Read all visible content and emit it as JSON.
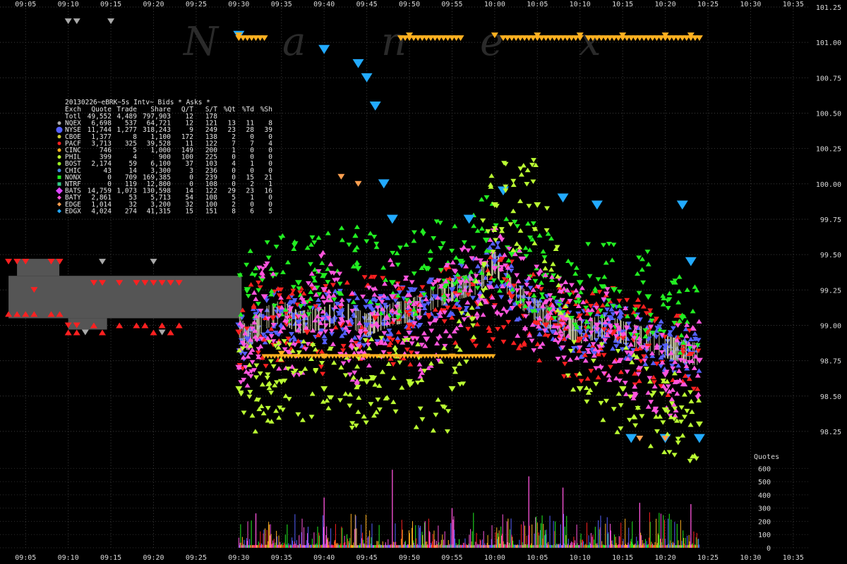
{
  "chart_data": [
    {
      "type": "scatter",
      "title": "",
      "watermark": [
        "N",
        "a",
        "n",
        "e",
        "x"
      ],
      "xlabel": "",
      "ylabel": "",
      "x_ticks": [
        "09:05",
        "09:10",
        "09:15",
        "09:20",
        "09:25",
        "09:30",
        "09:35",
        "09:40",
        "09:45",
        "09:50",
        "09:55",
        "10:00",
        "10:05",
        "10:10",
        "10:15",
        "10:20",
        "10:25",
        "10:30",
        "10:35"
      ],
      "xlim": [
        "09:02",
        "10:37"
      ],
      "y_ticks": [
        "98.25",
        "98.50",
        "98.75",
        "99.00",
        "99.25",
        "99.50",
        "99.75",
        "100.00",
        "100.25",
        "100.50",
        "100.75",
        "101.00",
        "101.25"
      ],
      "ylim": [
        98.15,
        101.25
      ],
      "grid": true,
      "series": [
        {
          "name": "NYSE",
          "color": "#5560ff",
          "x": [
            "09:30",
            "09:31",
            "09:33",
            "09:35",
            "09:37",
            "09:40",
            "09:42",
            "09:45",
            "09:48",
            "09:50",
            "09:53",
            "09:55",
            "09:58",
            "10:00",
            "10:02",
            "10:05",
            "10:08",
            "10:10",
            "10:13",
            "10:15",
            "10:18",
            "10:20",
            "10:23"
          ],
          "y": [
            99.0,
            98.9,
            99.05,
            99.1,
            99.02,
            99.05,
            99.1,
            99.0,
            99.08,
            99.1,
            99.2,
            99.25,
            99.3,
            99.45,
            99.25,
            99.1,
            99.0,
            98.95,
            99.0,
            98.95,
            98.9,
            98.85,
            98.8
          ]
        },
        {
          "name": "PACF",
          "color": "#ff2020",
          "x": [
            "09:30",
            "09:34",
            "09:38",
            "09:42",
            "09:46",
            "09:50",
            "09:54",
            "09:58",
            "10:02",
            "10:06",
            "10:10",
            "10:14",
            "10:18",
            "10:22"
          ],
          "y": [
            98.95,
            99.05,
            98.95,
            99.0,
            99.05,
            99.0,
            99.1,
            99.15,
            99.2,
            99.0,
            98.9,
            98.95,
            98.85,
            98.8
          ]
        },
        {
          "name": "NONX",
          "color": "#22ee22",
          "x": [
            "09:31",
            "09:34",
            "09:37",
            "09:40",
            "09:44",
            "09:48",
            "09:52",
            "09:56",
            "09:59",
            "10:02",
            "10:06",
            "10:10",
            "10:14",
            "10:18",
            "10:22"
          ],
          "y": [
            99.25,
            99.35,
            99.3,
            99.35,
            99.4,
            99.3,
            99.4,
            99.45,
            99.6,
            99.5,
            99.35,
            99.3,
            99.25,
            99.2,
            99.05
          ]
        },
        {
          "name": "BATS",
          "color": "#ff55dd",
          "x": [
            "09:30",
            "09:33",
            "09:36",
            "09:40",
            "09:44",
            "09:48",
            "09:52",
            "09:56",
            "10:00",
            "10:04",
            "10:08",
            "10:12",
            "10:16",
            "10:20",
            "10:24"
          ],
          "y": [
            98.7,
            99.2,
            98.8,
            99.25,
            98.85,
            99.2,
            98.9,
            99.3,
            99.4,
            99.15,
            99.05,
            99.0,
            98.8,
            98.65,
            98.75
          ]
        },
        {
          "name": "EDGX",
          "color": "#22aaff",
          "x": [
            "09:30",
            "09:40",
            "09:44",
            "09:45",
            "09:46",
            "09:47",
            "09:48",
            "09:57",
            "10:01",
            "10:08",
            "10:12",
            "10:16",
            "10:20",
            "10:22",
            "10:23",
            "10:24"
          ],
          "y": [
            101.05,
            100.95,
            100.85,
            100.75,
            100.55,
            100.0,
            99.75,
            99.75,
            99.95,
            99.9,
            99.85,
            98.2,
            98.2,
            99.85,
            99.45,
            98.2
          ]
        },
        {
          "name": "CINC",
          "color": "#ffb020",
          "x": [
            "09:30",
            "09:35",
            "09:40",
            "09:45",
            "09:50",
            "09:55",
            "10:00",
            "10:05",
            "10:10",
            "10:15",
            "10:20",
            "10:23"
          ],
          "y": [
            101.05,
            98.8,
            98.78,
            98.78,
            101.05,
            98.78,
            101.05,
            101.05,
            101.05,
            101.05,
            101.05,
            101.05
          ]
        },
        {
          "name": "PHIL",
          "color": "#bbff33",
          "x": [
            "09:30",
            "09:35",
            "09:40",
            "09:45",
            "09:50",
            "09:55",
            "10:00",
            "10:05",
            "10:10",
            "10:15",
            "10:20",
            "10:24"
          ],
          "y": [
            98.55,
            98.6,
            98.55,
            98.6,
            98.6,
            98.55,
            99.85,
            99.85,
            98.55,
            98.55,
            98.4,
            98.3
          ]
        },
        {
          "name": "NQEX",
          "color": "#aaaaaa",
          "x": [
            "09:10",
            "09:11",
            "09:12",
            "09:14",
            "09:15",
            "09:20",
            "09:21"
          ],
          "y": [
            101.15,
            101.15,
            98.95,
            99.45,
            101.15,
            99.45,
            98.95
          ]
        },
        {
          "name": "EDGE",
          "color": "#ffa050",
          "x": [
            "09:42",
            "09:44",
            "10:17",
            "10:20"
          ],
          "y": [
            100.05,
            100.0,
            98.2,
            98.2
          ]
        }
      ],
      "pre_open_band": {
        "x_start": "09:03",
        "x_end": "09:30",
        "y_low": 99.05,
        "y_high": 99.35,
        "color": "#555555"
      },
      "pre_open_quotes": {
        "color": "#ff2020",
        "x": [
          "09:03",
          "09:04",
          "09:05",
          "09:06",
          "09:08",
          "09:09",
          "09:10",
          "09:11",
          "09:13",
          "09:14",
          "09:16",
          "09:18",
          "09:19",
          "09:20",
          "09:21",
          "09:22",
          "09:23"
        ],
        "y_ask": [
          99.45,
          99.45,
          99.45,
          99.25,
          99.45,
          99.45,
          99.0,
          99.0,
          99.3,
          99.3,
          99.3,
          99.3,
          99.3,
          99.3,
          99.3,
          99.3,
          99.3
        ],
        "y_bid": [
          99.08,
          99.08,
          99.08,
          99.08,
          99.08,
          99.08,
          98.95,
          98.95,
          99.0,
          98.95,
          99.0,
          99.0,
          99.0,
          98.95,
          99.0,
          98.95,
          99.0
        ]
      }
    },
    {
      "type": "bar",
      "title": "",
      "ylabel": "Quotes",
      "y_ticks": [
        "0",
        "100",
        "200",
        "300",
        "400",
        "500",
        "600"
      ],
      "ylim": [
        0,
        650
      ],
      "peaks": [
        {
          "x": "09:48",
          "value": 590
        },
        {
          "x": "10:08",
          "value": 455
        },
        {
          "x": "10:04",
          "value": 540
        },
        {
          "x": "09:40",
          "value": 380
        },
        {
          "x": "10:17",
          "value": 340
        },
        {
          "x": "10:23",
          "value": 330
        },
        {
          "x": "09:32",
          "value": 260
        },
        {
          "x": "09:55",
          "value": 300
        }
      ],
      "colors": [
        "#ff55dd",
        "#5560ff",
        "#22ee22",
        "#ffb020",
        "#ff2020"
      ]
    }
  ],
  "stats_table": {
    "title": "20130226~eBRK~5s Intv~ Bids * Asks *",
    "columns": [
      "Exch",
      "Quote",
      "Trade",
      "Share",
      "Q/T",
      "S/T",
      "%Qt",
      "%Td",
      "%Sh"
    ],
    "rows": [
      {
        "exch": "Totl",
        "quote": "49,552",
        "trade": "4,489",
        "share": "797,903",
        "qt": "12",
        "st": "178",
        "pq": "",
        "pt": "",
        "ps": "",
        "color": "",
        "marker": "none"
      },
      {
        "exch": "NQEX",
        "quote": "6,698",
        "trade": "537",
        "share": "64,721",
        "qt": "12",
        "st": "121",
        "pq": "13",
        "pt": "11",
        "ps": "8",
        "color": "#aaaaaa",
        "marker": "circle"
      },
      {
        "exch": "NYSE",
        "quote": "11,744",
        "trade": "1,277",
        "share": "318,243",
        "qt": "9",
        "st": "249",
        "pq": "23",
        "pt": "28",
        "ps": "39",
        "color": "#5560ff",
        "marker": "big-circle"
      },
      {
        "exch": "CBOE",
        "quote": "1,377",
        "trade": "8",
        "share": "1,100",
        "qt": "172",
        "st": "138",
        "pq": "2",
        "pt": "0",
        "ps": "0",
        "color": "#cccc33",
        "marker": "circle"
      },
      {
        "exch": "PACF",
        "quote": "3,713",
        "trade": "325",
        "share": "39,528",
        "qt": "11",
        "st": "122",
        "pq": "7",
        "pt": "7",
        "ps": "4",
        "color": "#ff2020",
        "marker": "circle"
      },
      {
        "exch": "CINC",
        "quote": "746",
        "trade": "5",
        "share": "1,000",
        "qt": "149",
        "st": "200",
        "pq": "1",
        "pt": "0",
        "ps": "0",
        "color": "#ffb020",
        "marker": "circle"
      },
      {
        "exch": "PHIL",
        "quote": "399",
        "trade": "4",
        "share": "900",
        "qt": "100",
        "st": "225",
        "pq": "0",
        "pt": "0",
        "ps": "0",
        "color": "#bbff33",
        "marker": "circle"
      },
      {
        "exch": "BOST",
        "quote": "2,174",
        "trade": "59",
        "share": "6,100",
        "qt": "37",
        "st": "103",
        "pq": "4",
        "pt": "1",
        "ps": "0",
        "color": "#99ee22",
        "marker": "circle"
      },
      {
        "exch": "CHIC",
        "quote": "43",
        "trade": "14",
        "share": "3,300",
        "qt": "3",
        "st": "236",
        "pq": "0",
        "pt": "0",
        "ps": "0",
        "color": "#4488dd",
        "marker": "circle"
      },
      {
        "exch": "NONX",
        "quote": "0",
        "trade": "709",
        "share": "169,385",
        "qt": "0",
        "st": "239",
        "pq": "0",
        "pt": "15",
        "ps": "21",
        "color": "#22ee22",
        "marker": "square"
      },
      {
        "exch": "NTRF",
        "quote": "0",
        "trade": "119",
        "share": "12,800",
        "qt": "0",
        "st": "108",
        "pq": "0",
        "pt": "2",
        "ps": "1",
        "color": "#33cc88",
        "marker": "square"
      },
      {
        "exch": "BATS",
        "quote": "14,759",
        "trade": "1,073",
        "share": "130,598",
        "qt": "14",
        "st": "122",
        "pq": "29",
        "pt": "23",
        "ps": "16",
        "color": "#dd44ff",
        "marker": "big-diamond"
      },
      {
        "exch": "BATY",
        "quote": "2,861",
        "trade": "53",
        "share": "5,713",
        "qt": "54",
        "st": "108",
        "pq": "5",
        "pt": "1",
        "ps": "0",
        "color": "#ff55dd",
        "marker": "diamond"
      },
      {
        "exch": "EDGE",
        "quote": "1,014",
        "trade": "32",
        "share": "3,200",
        "qt": "32",
        "st": "100",
        "pq": "2",
        "pt": "0",
        "ps": "0",
        "color": "#ffa050",
        "marker": "diamond"
      },
      {
        "exch": "EDGX",
        "quote": "4,024",
        "trade": "274",
        "share": "41,315",
        "qt": "15",
        "st": "151",
        "pq": "8",
        "pt": "6",
        "ps": "5",
        "color": "#22aaff",
        "marker": "diamond"
      }
    ]
  }
}
